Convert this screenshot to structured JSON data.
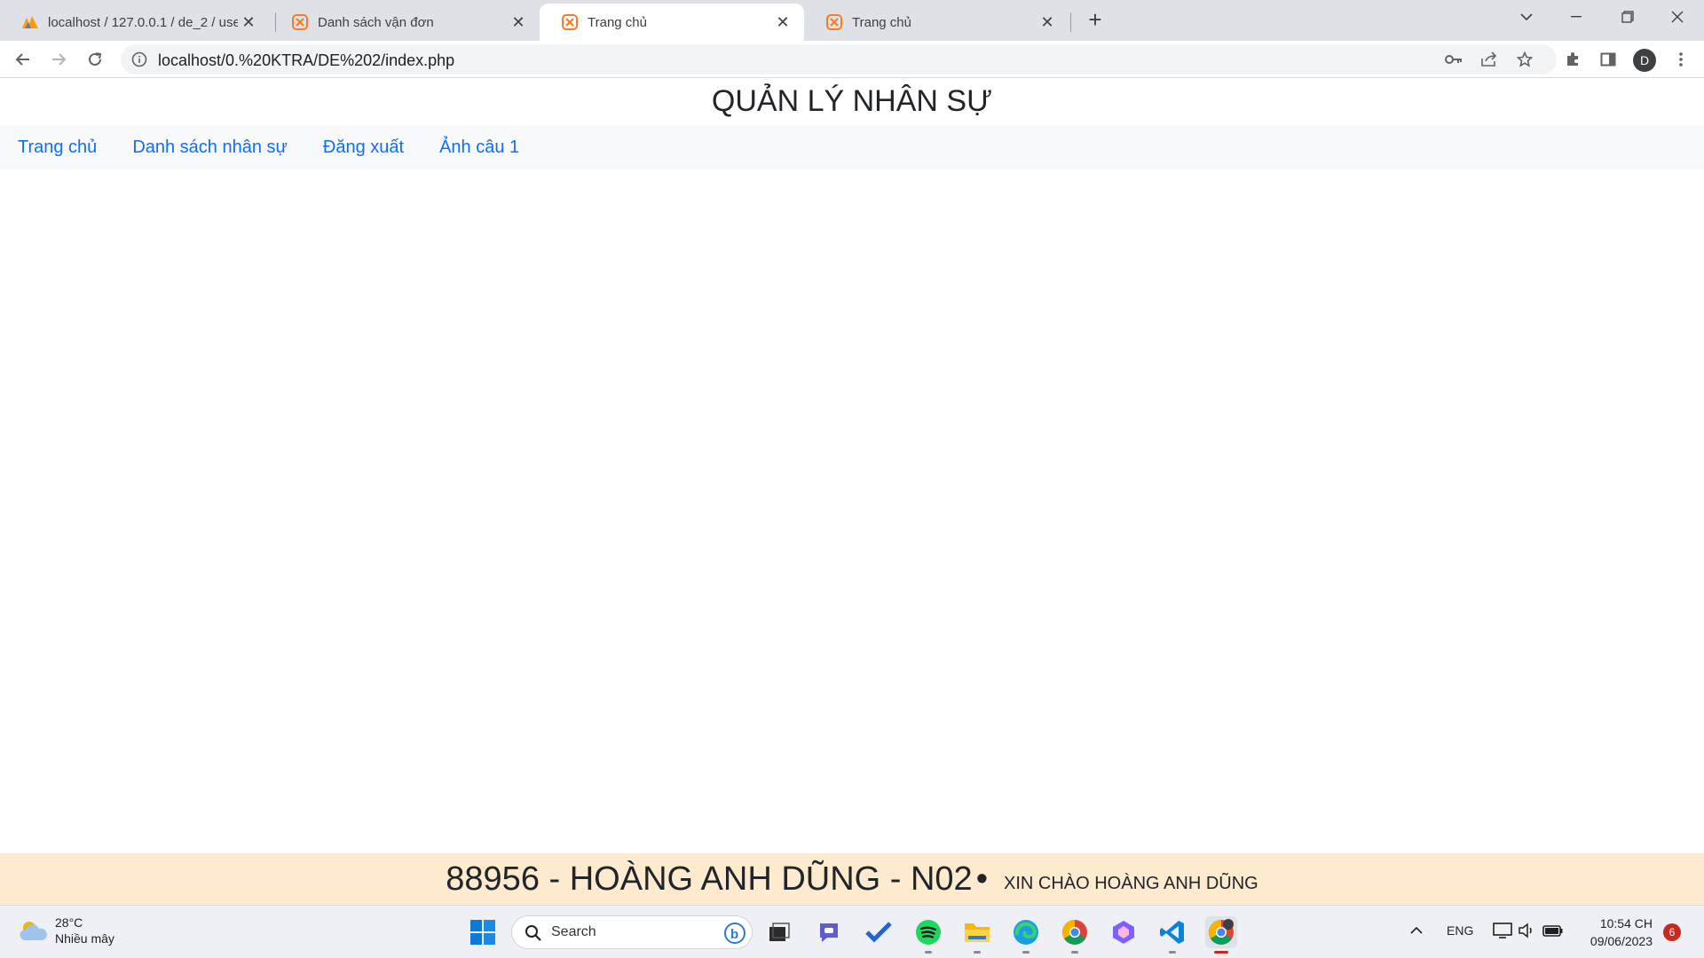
{
  "browser": {
    "tabs": [
      {
        "title": "localhost / 127.0.0.1 / de_2 / user",
        "favicon": "phpmyadmin-icon",
        "active": false
      },
      {
        "title": "Danh sách vận đơn",
        "favicon": "xampp-icon",
        "active": false
      },
      {
        "title": "Trang chủ",
        "favicon": "xampp-icon",
        "active": true
      },
      {
        "title": "Trang chủ",
        "favicon": "xampp-icon",
        "active": false
      }
    ],
    "url": "localhost/0.%20KTRA/DE%202/index.php",
    "profile_initial": "D"
  },
  "page": {
    "title": "QUẢN LÝ NHÂN SỰ",
    "nav": [
      {
        "label": "Trang chủ"
      },
      {
        "label": "Danh sách nhân sự"
      },
      {
        "label": "Đăng xuất"
      },
      {
        "label": "Ảnh câu 1"
      }
    ],
    "footer": {
      "main": "88956 - HOÀNG ANH DŨNG - N02",
      "bullet": "•",
      "greeting": "XIN CHÀO HOÀNG ANH DŨNG"
    },
    "colors": {
      "nav_link": "#0d6efd",
      "navbar_bg": "#f8f9fa",
      "footer_bg": "#fdeacf"
    }
  },
  "taskbar": {
    "weather": {
      "temp": "28°C",
      "condition": "Nhiều mây"
    },
    "search_label": "Search",
    "language": "ENG",
    "time": "10:54 CH",
    "date": "09/06/2023",
    "notification_count": "6",
    "apps": [
      "windows-start-icon",
      "task-view-icon",
      "teams-chat-icon",
      "todo-icon",
      "spotify-icon",
      "file-explorer-icon",
      "edge-icon",
      "chrome-icon",
      "copilot-icon",
      "vscode-icon",
      "chrome-profile-icon"
    ]
  }
}
